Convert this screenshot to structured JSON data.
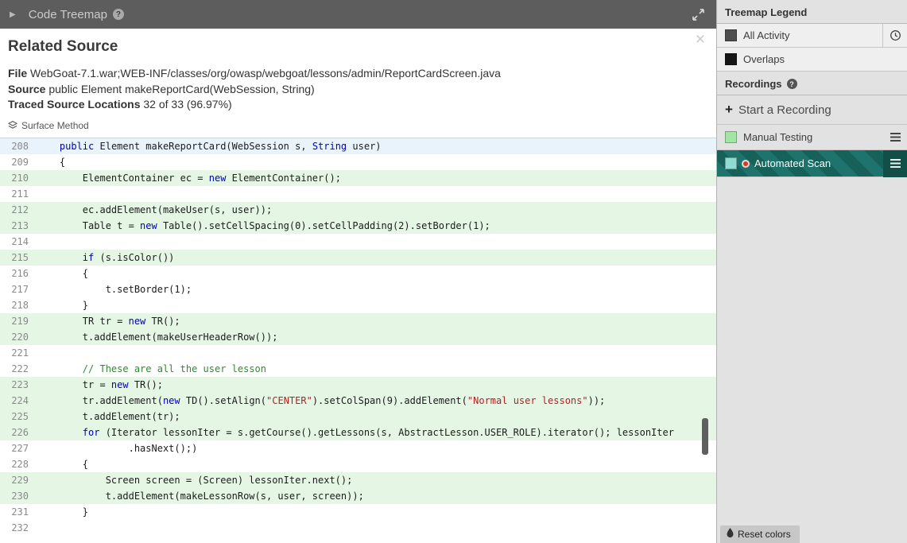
{
  "header": {
    "title": "Code Treemap"
  },
  "icons": {
    "help": "?",
    "close": "×",
    "collapse": "▶",
    "plus": "+"
  },
  "panel": {
    "title": "Related Source",
    "file_label": "File",
    "file_value": "WebGoat-7.1.war;WEB-INF/classes/org/owasp/webgoat/lessons/admin/ReportCardScreen.java",
    "source_label": "Source",
    "source_value": "public Element makeReportCard(WebSession, String)",
    "traced_label": "Traced Source Locations",
    "traced_value": "32 of 33 (96.97%)",
    "surface_method": "Surface Method"
  },
  "colors": {
    "keyword": "#0000c0",
    "string": "#b22222",
    "comment": "#2e8b2e",
    "line_selected": "#e9f3fb",
    "line_traced": "#e5f6e5"
  },
  "code": {
    "lines": [
      {
        "n": 208,
        "bg": "sel",
        "parts": [
          [
            "    ",
            ""
          ],
          [
            "public",
            "kw"
          ],
          [
            " Element makeReportCard(WebSession s, ",
            ""
          ],
          [
            "String",
            "kw"
          ],
          [
            " user)",
            ""
          ]
        ]
      },
      {
        "n": 209,
        "bg": "",
        "parts": [
          [
            "    {",
            ""
          ]
        ]
      },
      {
        "n": 210,
        "bg": "hl",
        "parts": [
          [
            "        ElementContainer ec = ",
            ""
          ],
          [
            "new",
            "kw"
          ],
          [
            " ElementContainer();",
            ""
          ]
        ]
      },
      {
        "n": 211,
        "bg": "",
        "parts": []
      },
      {
        "n": 212,
        "bg": "hl",
        "parts": [
          [
            "        ec.addElement(makeUser(s, user));",
            ""
          ]
        ]
      },
      {
        "n": 213,
        "bg": "hl",
        "parts": [
          [
            "        Table t = ",
            ""
          ],
          [
            "new",
            "kw"
          ],
          [
            " Table().setCellSpacing(0).setCellPadding(2).setBorder(1);",
            ""
          ]
        ]
      },
      {
        "n": 214,
        "bg": "",
        "parts": []
      },
      {
        "n": 215,
        "bg": "hl",
        "parts": [
          [
            "        ",
            ""
          ],
          [
            "if",
            "kw"
          ],
          [
            " (s.isColor())",
            ""
          ]
        ]
      },
      {
        "n": 216,
        "bg": "",
        "parts": [
          [
            "        {",
            ""
          ]
        ]
      },
      {
        "n": 217,
        "bg": "",
        "parts": [
          [
            "            t.setBorder(1);",
            ""
          ]
        ]
      },
      {
        "n": 218,
        "bg": "",
        "parts": [
          [
            "        }",
            ""
          ]
        ]
      },
      {
        "n": 219,
        "bg": "hl",
        "parts": [
          [
            "        TR tr = ",
            ""
          ],
          [
            "new",
            "kw"
          ],
          [
            " TR();",
            ""
          ]
        ]
      },
      {
        "n": 220,
        "bg": "hl",
        "parts": [
          [
            "        t.addElement(makeUserHeaderRow());",
            ""
          ]
        ]
      },
      {
        "n": 221,
        "bg": "",
        "parts": []
      },
      {
        "n": 222,
        "bg": "",
        "parts": [
          [
            "        ",
            ""
          ],
          [
            "// These are all the user lesson",
            "com"
          ]
        ]
      },
      {
        "n": 223,
        "bg": "hl",
        "parts": [
          [
            "        tr = ",
            ""
          ],
          [
            "new",
            "kw"
          ],
          [
            " TR();",
            ""
          ]
        ]
      },
      {
        "n": 224,
        "bg": "hl",
        "parts": [
          [
            "        tr.addElement(",
            ""
          ],
          [
            "new",
            "kw"
          ],
          [
            " TD().setAlign(",
            ""
          ],
          [
            "\"CENTER\"",
            "str"
          ],
          [
            ").setColSpan(9).addElement(",
            ""
          ],
          [
            "\"Normal user lessons\"",
            "str"
          ],
          [
            "));",
            ""
          ]
        ]
      },
      {
        "n": 225,
        "bg": "hl",
        "parts": [
          [
            "        t.addElement(tr);",
            ""
          ]
        ]
      },
      {
        "n": 226,
        "bg": "hl",
        "parts": [
          [
            "        ",
            ""
          ],
          [
            "for",
            "kw"
          ],
          [
            " (Iterator lessonIter = s.getCourse().getLessons(s, AbstractLesson.USER_ROLE).iterator(); lessonIter",
            ""
          ]
        ]
      },
      {
        "n": 227,
        "bg": "",
        "parts": [
          [
            "                .hasNext();)",
            ""
          ]
        ]
      },
      {
        "n": 228,
        "bg": "",
        "parts": [
          [
            "        {",
            ""
          ]
        ]
      },
      {
        "n": 229,
        "bg": "hl",
        "parts": [
          [
            "            Screen screen = (Screen) lessonIter.next();",
            ""
          ]
        ]
      },
      {
        "n": 230,
        "bg": "hl",
        "parts": [
          [
            "            t.addElement(makeLessonRow(s, user, screen));",
            ""
          ]
        ]
      },
      {
        "n": 231,
        "bg": "",
        "parts": [
          [
            "        }",
            ""
          ]
        ]
      },
      {
        "n": 232,
        "bg": "",
        "parts": []
      }
    ]
  },
  "sidebar": {
    "legend_title": "Treemap Legend",
    "legend": [
      {
        "label": "All Activity",
        "swatch": "#4d4d4d"
      },
      {
        "label": "Overlaps",
        "swatch": "#161616"
      }
    ],
    "recordings_title": "Recordings",
    "start_recording_label": "Start a Recording",
    "recordings": [
      {
        "label": "Manual Testing",
        "swatch": "#a3e6a3"
      },
      {
        "label": "Automated Scan",
        "swatch": "#8edcd4"
      }
    ],
    "reset_colors_label": "Reset colors"
  }
}
